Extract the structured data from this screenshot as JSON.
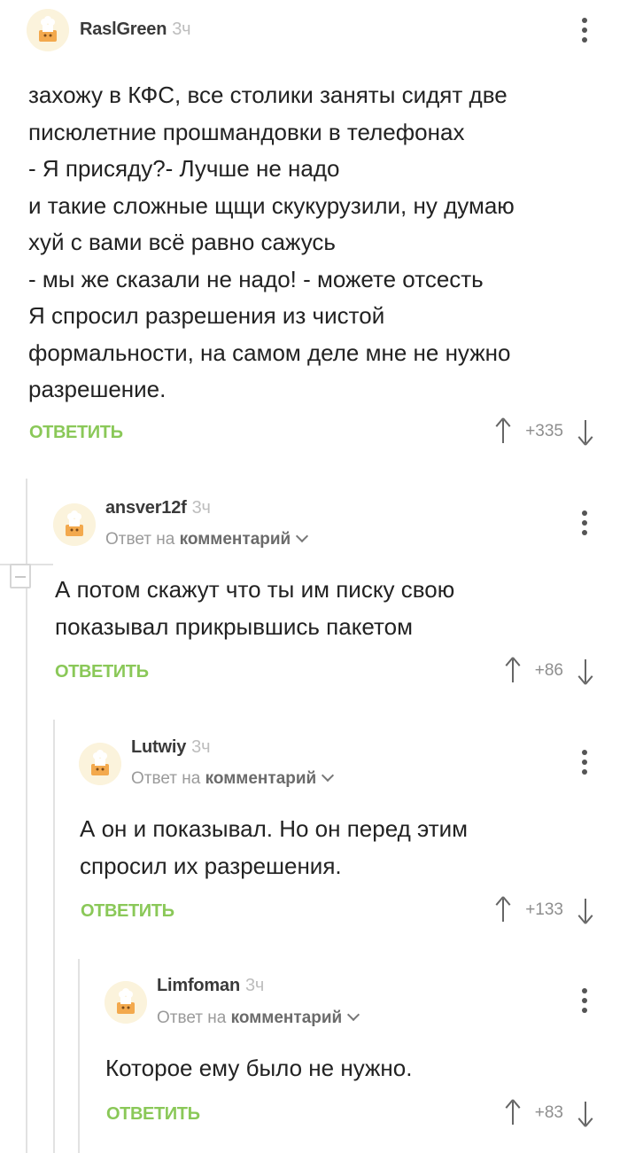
{
  "comments": [
    {
      "author": "RaslGreen",
      "time": "3ч",
      "lines": [
        "захожу в КФС, все столики заняты сидят две",
        "писюлетние прошмандовки в телефонах",
        "- Я присяду?- Лучше не надо",
        "и такие сложные щщи скукурузили, ну думаю",
        "хуй с вами всё равно сажусь",
        "- мы же сказали не надо! - можете отсесть",
        "Я спросил разрешения из чистой",
        "формальности, на самом деле мне не нужно",
        "разрешение."
      ],
      "reply_label": "ОТВЕТИТЬ",
      "score": "+335"
    },
    {
      "author": "ansver12f",
      "time": "3ч",
      "reply_prefix": "Ответ на",
      "reply_target": "комментарий",
      "lines": [
        "А потом скажут что ты им писку свою",
        "показывал прикрывшись пакетом"
      ],
      "reply_label": "ОТВЕТИТЬ",
      "score": "+86"
    },
    {
      "author": "Lutwiy",
      "time": "3ч",
      "reply_prefix": "Ответ на",
      "reply_target": "комментарий",
      "lines": [
        "А он и показывал. Но он перед этим",
        "спросил их разрешения."
      ],
      "reply_label": "ОТВЕТИТЬ",
      "score": "+133"
    },
    {
      "author": "Limfoman",
      "time": "3ч",
      "reply_prefix": "Ответ на",
      "reply_target": "комментарий",
      "lines": [
        "Которое ему было не нужно."
      ],
      "reply_label": "ОТВЕТИТЬ",
      "score": "+83"
    }
  ],
  "colors": {
    "reply_green": "#8ac858",
    "thread_line": "#e2e2e2",
    "time_gray": "#bdbdbd"
  },
  "icons": [
    "avatar-default-icon",
    "more-vertical-icon",
    "chevron-down-icon",
    "arrow-up-icon",
    "arrow-down-icon",
    "collapse-thread-icon"
  ]
}
